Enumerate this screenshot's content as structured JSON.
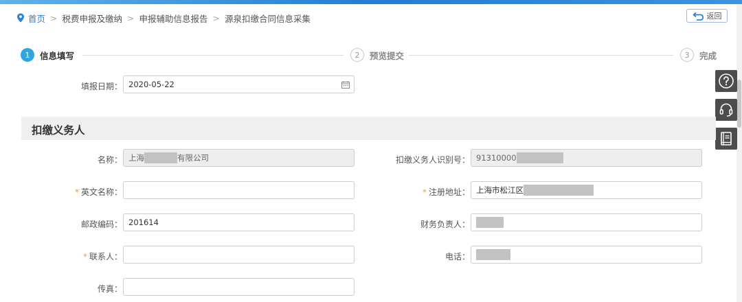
{
  "breadcrumb": {
    "home": "首页",
    "items": [
      "税费申报及缴纳",
      "申报辅助信息报告",
      "源泉扣缴合同信息采集"
    ],
    "separator": ">"
  },
  "back_button": {
    "label": "返回"
  },
  "steps": [
    {
      "number": "1",
      "label": "信息填写",
      "state": "active"
    },
    {
      "number": "2",
      "label": "预览提交",
      "state": "inactive"
    },
    {
      "number": "3",
      "label": "完成",
      "state": "inactive"
    }
  ],
  "fill_date": {
    "label": "填报日期：",
    "value": "2020-05-22"
  },
  "section": {
    "title": "扣缴义务人"
  },
  "fields": {
    "name": {
      "label": "名称：",
      "prefix": "上海",
      "suffix": "有限公司",
      "required": false
    },
    "withholder_id": {
      "label": "扣缴义务人识别号：",
      "prefix": "91310000",
      "required": false
    },
    "english_name": {
      "label": "英文名称：",
      "value": "",
      "required": true
    },
    "reg_address": {
      "label": "注册地址：",
      "prefix": "上海市松江区",
      "required": true
    },
    "postal_code": {
      "label": "邮政编码：",
      "value": "201614",
      "required": false
    },
    "finance_head": {
      "label": "财务负责人：",
      "value": "",
      "required": false
    },
    "contact": {
      "label": "联系人：",
      "value": "",
      "required": true
    },
    "phone": {
      "label": "电话：",
      "value": "",
      "required": false
    },
    "fax": {
      "label": "传真：",
      "value": "",
      "required": false
    }
  },
  "required_mark": "*",
  "tools": [
    "help-icon",
    "headset-icon",
    "book-icon"
  ],
  "colors": {
    "accent": "#2ea7e0",
    "link": "#2b82d9",
    "required": "#e6a23c",
    "tool_bg": "#4d4d4d"
  }
}
